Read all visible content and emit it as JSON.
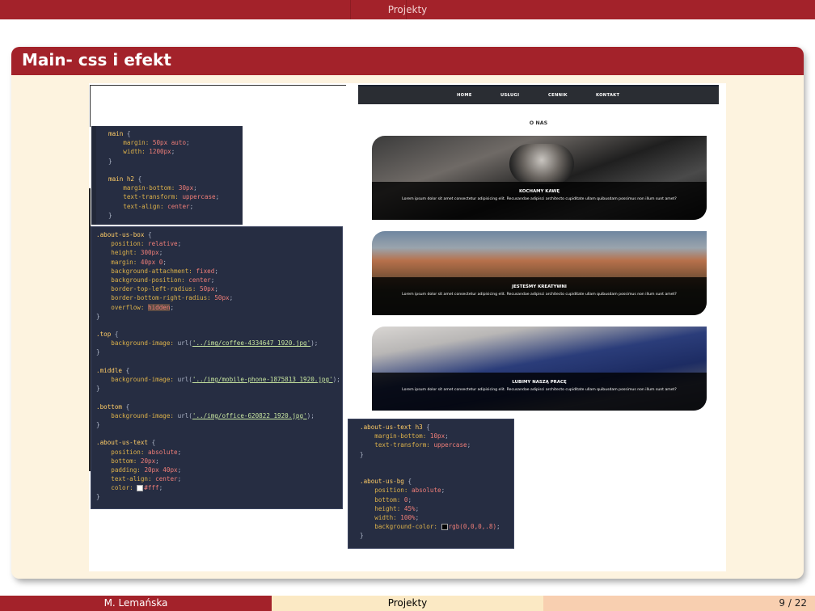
{
  "header": {
    "title": "Projekty"
  },
  "frame": {
    "title": "Main- css i efekt"
  },
  "code_main": [
    [
      {
        "t": "main",
        "c": "sel"
      },
      {
        "t": " {",
        "c": "punc"
      }
    ],
    [
      {
        "t": "    margin: ",
        "c": "prop"
      },
      {
        "t": "50px auto",
        "c": "val"
      },
      {
        "t": ";",
        "c": "punc"
      }
    ],
    [
      {
        "t": "    width: ",
        "c": "prop"
      },
      {
        "t": "1200px",
        "c": "val"
      },
      {
        "t": ";",
        "c": "punc"
      }
    ],
    [
      {
        "t": "}",
        "c": "punc"
      }
    ],
    [],
    [
      {
        "t": "main h2",
        "c": "sel"
      },
      {
        "t": " {",
        "c": "punc"
      }
    ],
    [
      {
        "t": "    margin-bottom: ",
        "c": "prop"
      },
      {
        "t": "30px",
        "c": "val"
      },
      {
        "t": ";",
        "c": "punc"
      }
    ],
    [
      {
        "t": "    text-transform: ",
        "c": "prop"
      },
      {
        "t": "uppercase",
        "c": "val"
      },
      {
        "t": ";",
        "c": "punc"
      }
    ],
    [
      {
        "t": "    text-align: ",
        "c": "prop"
      },
      {
        "t": "center",
        "c": "val"
      },
      {
        "t": ";",
        "c": "punc"
      }
    ],
    [
      {
        "t": "}",
        "c": "punc"
      }
    ]
  ],
  "code_about": [
    [
      {
        "t": ".about-us-box",
        "c": "sel"
      },
      {
        "t": " {",
        "c": "punc"
      }
    ],
    [
      {
        "t": "    position: ",
        "c": "prop"
      },
      {
        "t": "relative",
        "c": "val"
      },
      {
        "t": ";",
        "c": "punc"
      }
    ],
    [
      {
        "t": "    height: ",
        "c": "prop"
      },
      {
        "t": "300px",
        "c": "val"
      },
      {
        "t": ";",
        "c": "punc"
      }
    ],
    [
      {
        "t": "    margin: ",
        "c": "prop"
      },
      {
        "t": "40px 0",
        "c": "val"
      },
      {
        "t": ";",
        "c": "punc"
      }
    ],
    [
      {
        "t": "    background-attachment: ",
        "c": "prop"
      },
      {
        "t": "fixed",
        "c": "val"
      },
      {
        "t": ";",
        "c": "punc"
      }
    ],
    [
      {
        "t": "    background-position: ",
        "c": "prop"
      },
      {
        "t": "center",
        "c": "val"
      },
      {
        "t": ";",
        "c": "punc"
      }
    ],
    [
      {
        "t": "    border-top-left-radius: ",
        "c": "prop"
      },
      {
        "t": "50px",
        "c": "val"
      },
      {
        "t": ";",
        "c": "punc"
      }
    ],
    [
      {
        "t": "    border-bottom-right-radius: ",
        "c": "prop"
      },
      {
        "t": "50px",
        "c": "val"
      },
      {
        "t": ";",
        "c": "punc"
      }
    ],
    [
      {
        "t": "    overflow: ",
        "c": "prop"
      },
      {
        "t": "hidden",
        "c": "val hl"
      },
      {
        "t": ";",
        "c": "punc"
      }
    ],
    [
      {
        "t": "}",
        "c": "punc"
      }
    ],
    [],
    [
      {
        "t": ".top",
        "c": "sel"
      },
      {
        "t": " {",
        "c": "punc"
      }
    ],
    [
      {
        "t": "    background-image: ",
        "c": "prop"
      },
      {
        "t": "url(",
        "c": "punc"
      },
      {
        "t": "'../img/coffee-4334647_1920.jpg'",
        "c": "str"
      },
      {
        "t": ");",
        "c": "punc"
      }
    ],
    [
      {
        "t": "}",
        "c": "punc"
      }
    ],
    [],
    [
      {
        "t": ".middle",
        "c": "sel"
      },
      {
        "t": " {",
        "c": "punc"
      }
    ],
    [
      {
        "t": "    background-image: ",
        "c": "prop"
      },
      {
        "t": "url(",
        "c": "punc"
      },
      {
        "t": "'../img/mobile-phone-1875813_1920.jpg'",
        "c": "str"
      },
      {
        "t": ");",
        "c": "punc"
      }
    ],
    [
      {
        "t": "}",
        "c": "punc"
      }
    ],
    [],
    [
      {
        "t": ".bottom",
        "c": "sel"
      },
      {
        "t": " {",
        "c": "punc"
      }
    ],
    [
      {
        "t": "    background-image: ",
        "c": "prop"
      },
      {
        "t": "url(",
        "c": "punc"
      },
      {
        "t": "'../img/office-620822_1920.jpg'",
        "c": "str"
      },
      {
        "t": ");",
        "c": "punc"
      }
    ],
    [
      {
        "t": "}",
        "c": "punc"
      }
    ],
    [],
    [
      {
        "t": ".about-us-text",
        "c": "sel"
      },
      {
        "t": " {",
        "c": "punc"
      }
    ],
    [
      {
        "t": "    position: ",
        "c": "prop"
      },
      {
        "t": "absolute",
        "c": "val"
      },
      {
        "t": ";",
        "c": "punc"
      }
    ],
    [
      {
        "t": "    bottom: ",
        "c": "prop"
      },
      {
        "t": "20px",
        "c": "val"
      },
      {
        "t": ";",
        "c": "punc"
      }
    ],
    [
      {
        "t": "    padding: ",
        "c": "prop"
      },
      {
        "t": "20px 40px",
        "c": "val"
      },
      {
        "t": ";",
        "c": "punc"
      }
    ],
    [
      {
        "t": "    text-align: ",
        "c": "prop"
      },
      {
        "t": "center",
        "c": "val"
      },
      {
        "t": ";",
        "c": "punc"
      }
    ],
    [
      {
        "t": "    color: ",
        "c": "prop"
      },
      {
        "t": "",
        "c": "swatch-white"
      },
      {
        "t": "#fff",
        "c": "val"
      },
      {
        "t": ";",
        "c": "punc"
      }
    ],
    [
      {
        "t": "}",
        "c": "punc"
      }
    ]
  ],
  "code_text": [
    [
      {
        "t": ".about-us-text h3",
        "c": "sel"
      },
      {
        "t": " {",
        "c": "punc"
      }
    ],
    [
      {
        "t": "    margin-bottom: ",
        "c": "prop"
      },
      {
        "t": "10px",
        "c": "val"
      },
      {
        "t": ";",
        "c": "punc"
      }
    ],
    [
      {
        "t": "    text-transform: ",
        "c": "prop"
      },
      {
        "t": "uppercase",
        "c": "val"
      },
      {
        "t": ";",
        "c": "punc"
      }
    ],
    [
      {
        "t": "}",
        "c": "punc"
      }
    ],
    [],
    [],
    [
      {
        "t": ".about-us-bg",
        "c": "sel"
      },
      {
        "t": " {",
        "c": "punc"
      }
    ],
    [
      {
        "t": "    position: ",
        "c": "prop"
      },
      {
        "t": "absolute",
        "c": "val"
      },
      {
        "t": ";",
        "c": "punc"
      }
    ],
    [
      {
        "t": "    bottom: ",
        "c": "prop"
      },
      {
        "t": "0",
        "c": "val"
      },
      {
        "t": ";",
        "c": "punc"
      }
    ],
    [
      {
        "t": "    height: ",
        "c": "prop"
      },
      {
        "t": "45%",
        "c": "val"
      },
      {
        "t": ";",
        "c": "punc"
      }
    ],
    [
      {
        "t": "    width: ",
        "c": "prop"
      },
      {
        "t": "100%",
        "c": "val"
      },
      {
        "t": ";",
        "c": "punc"
      }
    ],
    [
      {
        "t": "    background-color: ",
        "c": "prop"
      },
      {
        "t": "",
        "c": "swatch-black"
      },
      {
        "t": "rgb(0,0,0,.8)",
        "c": "val"
      },
      {
        "t": ";",
        "c": "punc"
      }
    ],
    [
      {
        "t": "}",
        "c": "punc"
      }
    ]
  ],
  "site": {
    "nav": [
      "HOME",
      "USŁUGI",
      "CENNIK",
      "KONTAKT"
    ],
    "heading": "O NAS",
    "lorem": "Lorem ipsum dolor sit amet consectetur adipisicing elit. Recusandae adipisci architecto cupiditate ullam quibusdam possimus non illum sunt amet?",
    "cards": [
      {
        "title": "KOCHAMY KAWĘ"
      },
      {
        "title": "JESTEŚMY KREATYWNI"
      },
      {
        "title": "LUBIMY NASZĄ PRACĘ"
      }
    ]
  },
  "footer": {
    "author": "M. Lemańska",
    "title": "Projekty",
    "page": "9 / 22"
  },
  "colors": {
    "beamer_red": "#a3222a",
    "block_body": "#fdf3df",
    "editor_bg": "#262d42"
  }
}
